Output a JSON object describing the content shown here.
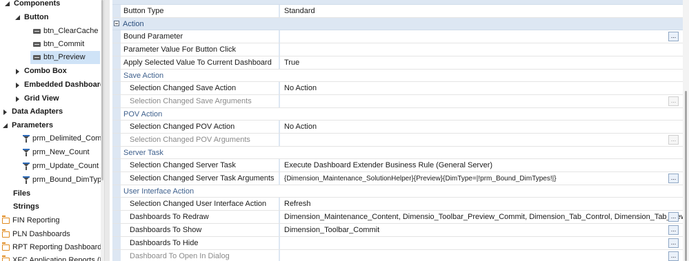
{
  "tree": {
    "components": "Components",
    "button": "Button",
    "btn_clearcache": "btn_ClearCache",
    "btn_commit": "btn_Commit",
    "btn_preview": "btn_Preview",
    "combo_box": "Combo Box",
    "embedded_dashboard": "Embedded Dashboard",
    "grid_view": "Grid View",
    "data_adapters": "Data Adapters",
    "parameters": "Parameters",
    "prm_delimited": "prm_Delimited_Comm",
    "prm_new_count": "prm_New_Count",
    "prm_update_count": "prm_Update_Count",
    "prm_bound_dimtype": "prm_Bound_DimType:",
    "files": "Files",
    "strings": "Strings",
    "fin_reporting": "FIN Reporting",
    "pln_dashboards": "PLN Dashboards",
    "rpt_reporting": "RPT Reporting Dashboards",
    "xfc_partial": "XFC Application Reports (RP"
  },
  "grid": {
    "button_type": {
      "name": "Button Type",
      "value": "Standard"
    },
    "action_category": "Action",
    "bound_parameter": {
      "name": "Bound Parameter",
      "value": ""
    },
    "param_value_click": {
      "name": "Parameter Value For Button Click",
      "value": ""
    },
    "apply_selected": {
      "name": "Apply Selected Value To Current Dashboard",
      "value": "True"
    },
    "save_action_group": "Save Action",
    "sel_changed_save_action": {
      "name": "Selection Changed Save Action",
      "value": "No Action"
    },
    "sel_changed_save_args": {
      "name": "Selection Changed Save Arguments",
      "value": ""
    },
    "pov_action_group": "POV Action",
    "sel_changed_pov_action": {
      "name": "Selection Changed POV Action",
      "value": "No Action"
    },
    "sel_changed_pov_args": {
      "name": "Selection Changed POV Arguments",
      "value": ""
    },
    "server_task_group": "Server Task",
    "sel_changed_server_task": {
      "name": "Selection Changed Server Task",
      "value": "Execute Dashboard Extender Business Rule (General Server)"
    },
    "sel_changed_server_args": {
      "name": "Selection Changed Server Task Arguments",
      "value": "{Dimension_Maintenance_SolutionHelper}{Preview}{DimType=|!prm_Bound_DimTypes!|}"
    },
    "ui_action_group": "User Interface Action",
    "sel_changed_ui_action": {
      "name": "Selection Changed User Interface Action",
      "value": "Refresh"
    },
    "dashboards_redraw": {
      "name": "Dashboards To Redraw",
      "value": "Dimension_Maintenance_Content, Dimensio_Toolbar_Preview_Commit, Dimension_Tab_Control, Dimension_Tab_New, Dimension_Tab_Update"
    },
    "dashboards_show": {
      "name": "Dashboards To Show",
      "value": "Dimension_Toolbar_Commit"
    },
    "dashboards_hide": {
      "name": "Dashboards To Hide",
      "value": ""
    },
    "dashboard_dialog": {
      "name": "Dashboard To Open In Dialog",
      "value": ""
    },
    "ellipsis_label": "..."
  }
}
